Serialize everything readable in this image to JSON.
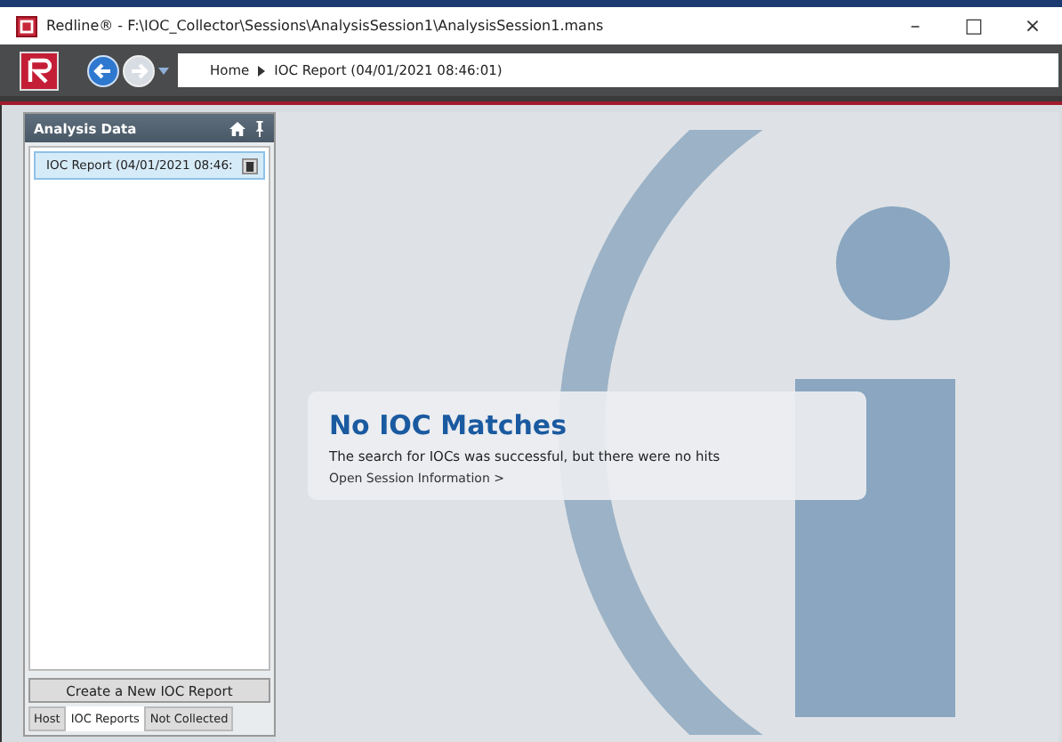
{
  "window": {
    "title": "Redline® - F:\\IOC_Collector\\Sessions\\AnalysisSession1\\AnalysisSession1.mans",
    "controls": [
      "–",
      "□",
      "×"
    ]
  },
  "breadcrumb": [
    {
      "label": "Home"
    },
    {
      "label": "IOC Report (04/01/2021 08:46:01)"
    }
  ],
  "sidebar": {
    "title": "Analysis Data",
    "items": [
      {
        "label": "IOC Report (04/01/2021 08:46:",
        "selected": true
      }
    ],
    "action": "Create a New IOC Report",
    "tabs": [
      {
        "label": "Host",
        "selected": false
      },
      {
        "label": "IOC Reports",
        "selected": true
      },
      {
        "label": "Not Collected",
        "selected": false
      }
    ]
  },
  "message": {
    "title": "No IOC Matches",
    "text": "The search for IOCs was successful, but there were no hits",
    "link": "Open Session Information >"
  }
}
